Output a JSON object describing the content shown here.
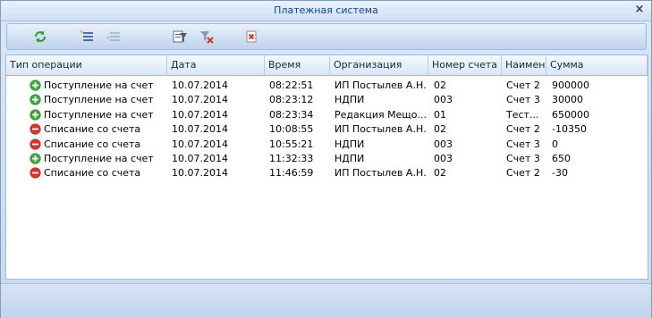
{
  "window": {
    "title": "Платежная система",
    "close_glyph": "×"
  },
  "toolbar": {
    "buttons": [
      {
        "name": "refresh-button",
        "icon": "refresh-icon"
      },
      {
        "name": "add-record-button",
        "icon": "add-list-icon"
      },
      {
        "name": "edit-record-button",
        "icon": "edit-list-icon",
        "disabled": true
      },
      {
        "name": "filter-button",
        "icon": "filter-icon"
      },
      {
        "name": "clear-filter-button",
        "icon": "clear-filter-icon"
      },
      {
        "name": "delete-button",
        "icon": "delete-icon"
      }
    ]
  },
  "grid": {
    "columns": [
      "Тип операции",
      "Дата",
      "Время",
      "Организация",
      "Номер счета",
      "Наименов",
      "Сумма"
    ],
    "rows": [
      {
        "type": "income",
        "op": "Поступление на счет",
        "date": "10.07.2014",
        "time": "08:22:51",
        "org": "ИП Постылев А.Н.",
        "account": "02",
        "name": "Счет 2",
        "sum": "900000"
      },
      {
        "type": "income",
        "op": "Поступление на счет",
        "date": "10.07.2014",
        "time": "08:23:12",
        "org": "НДПИ",
        "account": "003",
        "name": "Счет 3",
        "sum": "30000"
      },
      {
        "type": "income",
        "op": "Поступление на счет",
        "date": "10.07.2014",
        "time": "08:23:34",
        "org": "Редакция Мещо...",
        "account": "01",
        "name": "Тест...",
        "sum": "650000"
      },
      {
        "type": "expense",
        "op": "Списание со счета",
        "date": "10.07.2014",
        "time": "10:08:55",
        "org": "ИП Постылев А.Н.",
        "account": "02",
        "name": "Счет 2",
        "sum": "-10350"
      },
      {
        "type": "expense",
        "op": "Списание со счета",
        "date": "10.07.2014",
        "time": "10:55:21",
        "org": "НДПИ",
        "account": "003",
        "name": "Счет 3",
        "sum": "0"
      },
      {
        "type": "income",
        "op": "Поступление на счет",
        "date": "10.07.2014",
        "time": "11:32:33",
        "org": "НДПИ",
        "account": "003",
        "name": "Счет 3",
        "sum": "650"
      },
      {
        "type": "expense",
        "op": "Списание со счета",
        "date": "10.07.2014",
        "time": "11:46:59",
        "org": "ИП Постылев А.Н.",
        "account": "02",
        "name": "Счет 2",
        "sum": "-30"
      }
    ]
  },
  "colors": {
    "income": "#3aa838",
    "expense": "#d8332b",
    "title": "#15428b"
  }
}
